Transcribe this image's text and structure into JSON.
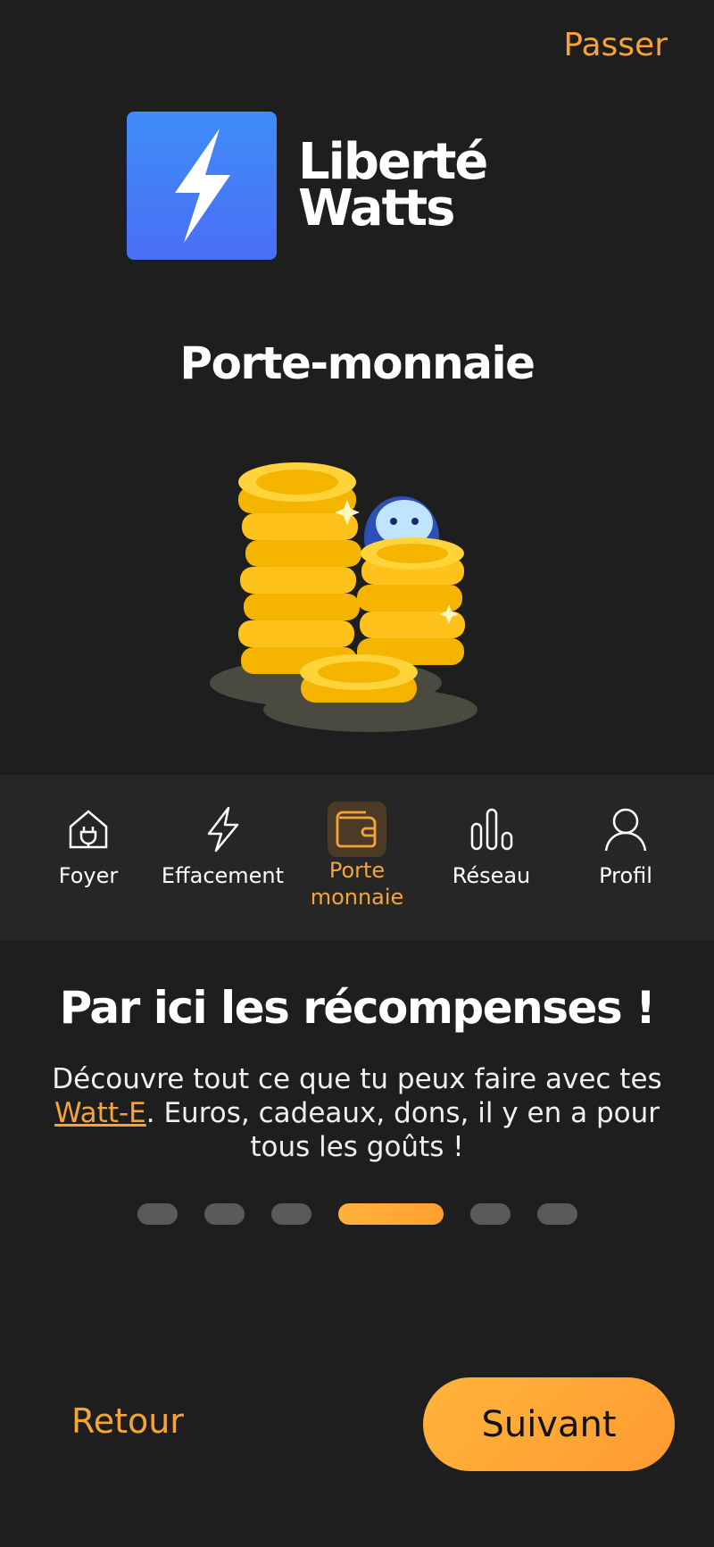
{
  "header": {
    "skip_label": "Passer"
  },
  "brand": {
    "line1": "Liberté",
    "line2": "Watts",
    "icon": "lightning-icon",
    "color_from": "#3f8df7",
    "color_to": "#4a6ef5"
  },
  "feature": {
    "title": "Porte-monnaie",
    "illustration": "coin-stack-mascot-icon"
  },
  "tabbar": {
    "items": [
      {
        "label": "Foyer",
        "icon": "house-plug-icon",
        "active": false
      },
      {
        "label": "Effacement",
        "icon": "lightning-icon",
        "active": false
      },
      {
        "label": "Porte\nmonnaie",
        "icon": "wallet-icon",
        "active": true
      },
      {
        "label": "Réseau",
        "icon": "bars-icon",
        "active": false
      },
      {
        "label": "Profil",
        "icon": "user-icon",
        "active": false
      }
    ]
  },
  "content": {
    "headline": "Par ici les récompenses !",
    "desc_before": "Découvre tout ce que tu peux faire avec tes ",
    "desc_link": "Watt-E",
    "desc_after": ". Euros, cadeaux, dons, il y en a pour tous les goûts !"
  },
  "pagination": {
    "count": 6,
    "active_index": 3
  },
  "footer": {
    "back_label": "Retour",
    "next_label": "Suivant"
  },
  "colors": {
    "accent": "#f5a43a",
    "background": "#1e1e1e",
    "tabbar": "#262626"
  }
}
